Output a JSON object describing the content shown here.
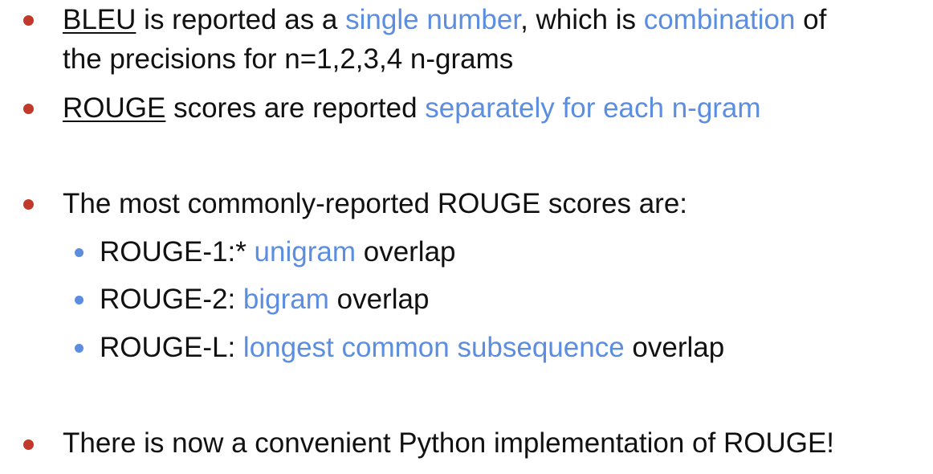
{
  "bullets": [
    {
      "line1": {
        "t1": "BLEU",
        "t2": " is reported as a ",
        "t3": "single number",
        "t4": ", which is ",
        "t5": "combination",
        "t6": " of"
      },
      "line2": "the precisions for n=1,2,3,4 n-grams"
    },
    {
      "t1": "ROUGE",
      "t2": " scores are reported ",
      "t3": "separately for each n-gram"
    },
    {
      "text": "The most commonly-reported ROUGE scores are:"
    },
    {
      "text": "There is now a convenient Python implementation of ROUGE!"
    }
  ],
  "subitems": [
    {
      "label": "ROUGE-1:* ",
      "highlight": "unigram",
      "rest": " overlap"
    },
    {
      "label": "ROUGE-2: ",
      "highlight": "bigram",
      "rest": " overlap"
    },
    {
      "label": "ROUGE-L: ",
      "highlight": "longest common subsequence",
      "rest": " overlap"
    }
  ],
  "colors": {
    "bullet": "#c0392b",
    "highlight": "#5b8de0",
    "text": "#111111"
  }
}
